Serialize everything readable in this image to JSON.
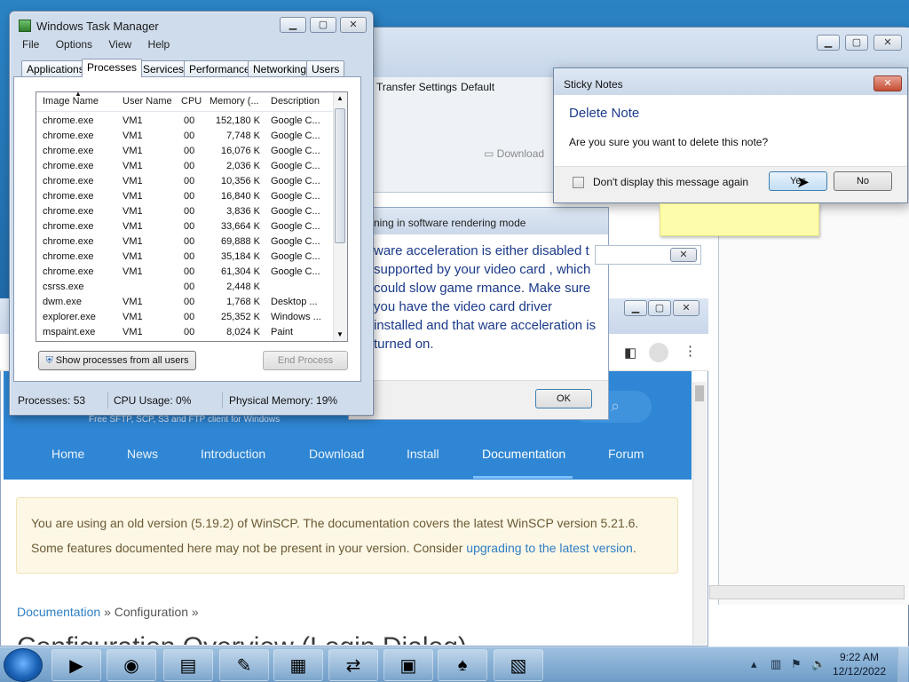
{
  "task_manager": {
    "title": "Windows Task Manager",
    "menu": [
      "File",
      "Options",
      "View",
      "Help"
    ],
    "tabs": [
      "Applications",
      "Processes",
      "Services",
      "Performance",
      "Networking",
      "Users"
    ],
    "selected_tab": "Processes",
    "columns": [
      "Image Name",
      "User Name",
      "CPU",
      "Memory (...",
      "Description"
    ],
    "rows": [
      [
        "chrome.exe",
        "VM1",
        "00",
        "152,180 K",
        "Google C..."
      ],
      [
        "chrome.exe",
        "VM1",
        "00",
        "7,748 K",
        "Google C..."
      ],
      [
        "chrome.exe",
        "VM1",
        "00",
        "16,076 K",
        "Google C..."
      ],
      [
        "chrome.exe",
        "VM1",
        "00",
        "2,036 K",
        "Google C..."
      ],
      [
        "chrome.exe",
        "VM1",
        "00",
        "10,356 K",
        "Google C..."
      ],
      [
        "chrome.exe",
        "VM1",
        "00",
        "16,840 K",
        "Google C..."
      ],
      [
        "chrome.exe",
        "VM1",
        "00",
        "3,836 K",
        "Google C..."
      ],
      [
        "chrome.exe",
        "VM1",
        "00",
        "33,664 K",
        "Google C..."
      ],
      [
        "chrome.exe",
        "VM1",
        "00",
        "69,888 K",
        "Google C..."
      ],
      [
        "chrome.exe",
        "VM1",
        "00",
        "35,184 K",
        "Google C..."
      ],
      [
        "chrome.exe",
        "VM1",
        "00",
        "61,304 K",
        "Google C..."
      ],
      [
        "csrss.exe",
        "",
        "00",
        "2,448 K",
        ""
      ],
      [
        "dwm.exe",
        "VM1",
        "00",
        "1,768 K",
        "Desktop ..."
      ],
      [
        "explorer.exe",
        "VM1",
        "00",
        "25,352 K",
        "Windows ..."
      ],
      [
        "mspaint.exe",
        "VM1",
        "00",
        "8,024 K",
        "Paint"
      ]
    ],
    "show_all_button": "Show processes from all users",
    "end_process_button": "End Process",
    "status": {
      "processes": "Processes: 53",
      "cpu": "CPU Usage: 0%",
      "memory": "Physical Memory: 19%"
    }
  },
  "winscp_bg": {
    "transfer_settings_label": "Transfer Settings",
    "transfer_settings_value": "Default",
    "download_label": "Download"
  },
  "game_dialog": {
    "title": "ning in software rendering mode",
    "body": "ware acceleration is either disabled t supported by your video card , which could slow game rmance. Make sure you have the video card driver installed and that ware acceleration is turned on.",
    "ok_button": "OK"
  },
  "sticky_dialog": {
    "title": "Sticky Notes",
    "heading": "Delete Note",
    "question": "Are you sure you want to delete this note?",
    "checkbox_label": "Don't display this message again",
    "yes_button": "Yes",
    "no_button": "No"
  },
  "browser": {
    "tagline": "Free SFTP, SCP, S3 and FTP client for Windows",
    "nav": [
      "Home",
      "News",
      "Introduction",
      "Download",
      "Install",
      "Documentation",
      "Forum"
    ],
    "active_nav": "Documentation",
    "notice_text": "You are using an old version (5.19.2) of WinSCP. The documentation covers the latest WinSCP version 5.21.6. Some features documented here may not be present in your version. Consider",
    "notice_link": "upgrading to the latest version",
    "notice_end": ".",
    "breadcrumb_link": "Documentation",
    "breadcrumb_rest": "» Configuration »",
    "page_heading": "Configuration Overview (Login Dialog)"
  },
  "taskbar": {
    "time": "9:22 AM",
    "date": "12/12/2022",
    "items": [
      "media-player-icon",
      "chrome-icon",
      "explorer-icon",
      "paint-icon",
      "notepad-icon",
      "winscp-icon",
      "task-manager-icon",
      "solitaire-icon",
      "sticky-notes-icon"
    ]
  }
}
